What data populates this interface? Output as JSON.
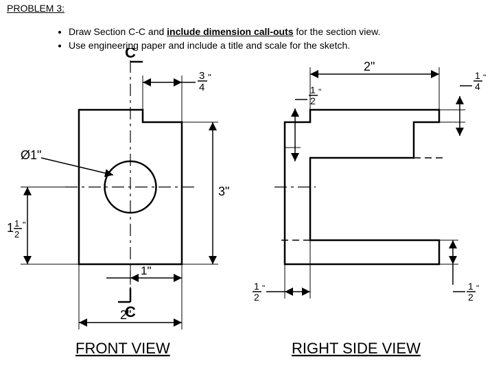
{
  "problem": {
    "title": "PROBLEM 3:",
    "bullet1_a": "Draw Section C-C and ",
    "bullet1_b": "include dimension call-outs",
    "bullet1_c": " for the section view.",
    "bullet2": "Use engineering paper and include a title and scale for the sketch."
  },
  "views": {
    "front_label": "FRONT VIEW",
    "right_label": "RIGHT SIDE VIEW"
  },
  "section": {
    "letter_top": "C",
    "letter_bottom": "C"
  },
  "dims": {
    "front": {
      "hole_dia": "Ø1\"",
      "hole_center_from_bottom_whole": "1",
      "hole_center_from_bottom_num": "1",
      "hole_center_from_bottom_den": "2",
      "hole_center_from_bottom_mark": "\"",
      "step_width_num": "3",
      "step_width_den": "4",
      "step_width_mark": "\"",
      "hole_offset": "1\"",
      "overall_width": "2\"",
      "overall_height": "3\""
    },
    "right": {
      "top_width": "2\"",
      "top_right_step_num": "1",
      "top_right_step_den": "4",
      "top_right_step_mark": "\"",
      "top_left_step_num": "1",
      "top_left_step_den": "2",
      "top_left_step_mark": "\"",
      "bottom_left_num": "1",
      "bottom_left_den": "2",
      "bottom_left_mark": "\"",
      "bottom_right_num": "1",
      "bottom_right_den": "2",
      "bottom_right_mark": "\""
    }
  },
  "chart_data": {
    "type": "table",
    "unit": "inches",
    "part": {
      "overall_width": 2,
      "overall_depth": 3,
      "overall_height": 3,
      "front_step_width": 0.75,
      "hole_diameter": 1,
      "hole_center_from_bottom": 1.5,
      "hole_center_from_left": 1,
      "right_view_top_opening_width": 2,
      "right_view_top_right_step": 0.25,
      "right_view_top_left_ledge_height": 0.5,
      "right_view_bottom_left_step": 0.5,
      "right_view_bottom_right_step": 0.5
    }
  }
}
